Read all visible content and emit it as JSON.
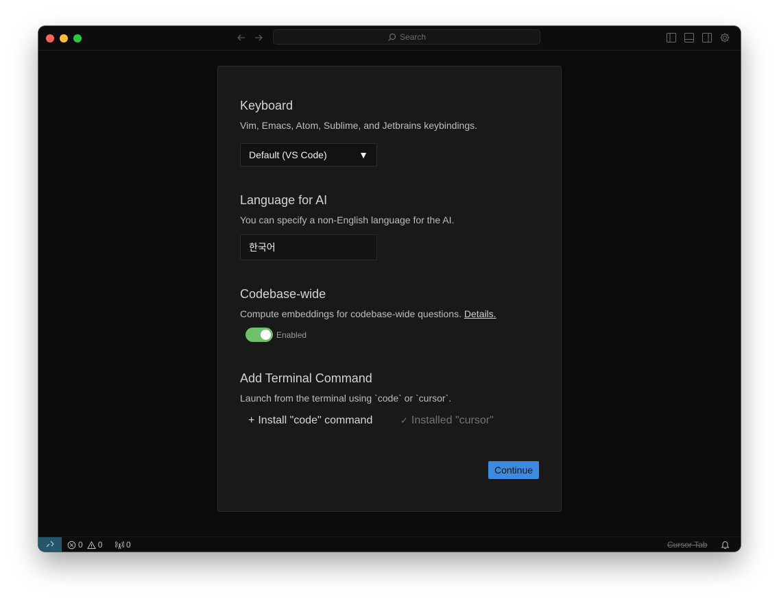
{
  "titlebar": {
    "search_placeholder": "Search",
    "icons": [
      "arrow-left-icon",
      "arrow-right-icon",
      "search-icon",
      "toggle-sidebar-icon",
      "toggle-panel-icon",
      "toggle-secondary-sidebar-icon",
      "gear-icon"
    ]
  },
  "onboarding": {
    "keyboard": {
      "title": "Keyboard",
      "description": "Vim, Emacs, Atom, Sublime, and Jetbrains keybindings.",
      "selected": "Default (VS Code)",
      "caret": "▼"
    },
    "language": {
      "title": "Language for AI",
      "description": "You can specify a non-English language for the AI.",
      "value": "한국어"
    },
    "codebase": {
      "title": "Codebase-wide",
      "description": "Compute embeddings for codebase-wide questions.",
      "link": "Details.",
      "toggle_label": "Enabled",
      "enabled": true
    },
    "terminal": {
      "title": "Add Terminal Command",
      "description": "Launch from the terminal using `code` or `cursor`.",
      "install_glyph": "+",
      "install_label": "Install \"code\" command",
      "installed_glyph": "✓",
      "installed_label": "Installed \"cursor\""
    },
    "continue_label": "Continue"
  },
  "statusbar": {
    "errors": "0",
    "warnings": "0",
    "ports": "0",
    "cursor_tab": "Cursor Tab"
  },
  "colors": {
    "accent": "#3b8be3",
    "toggle_on": "#6ec06b",
    "remote": "#25566a"
  }
}
